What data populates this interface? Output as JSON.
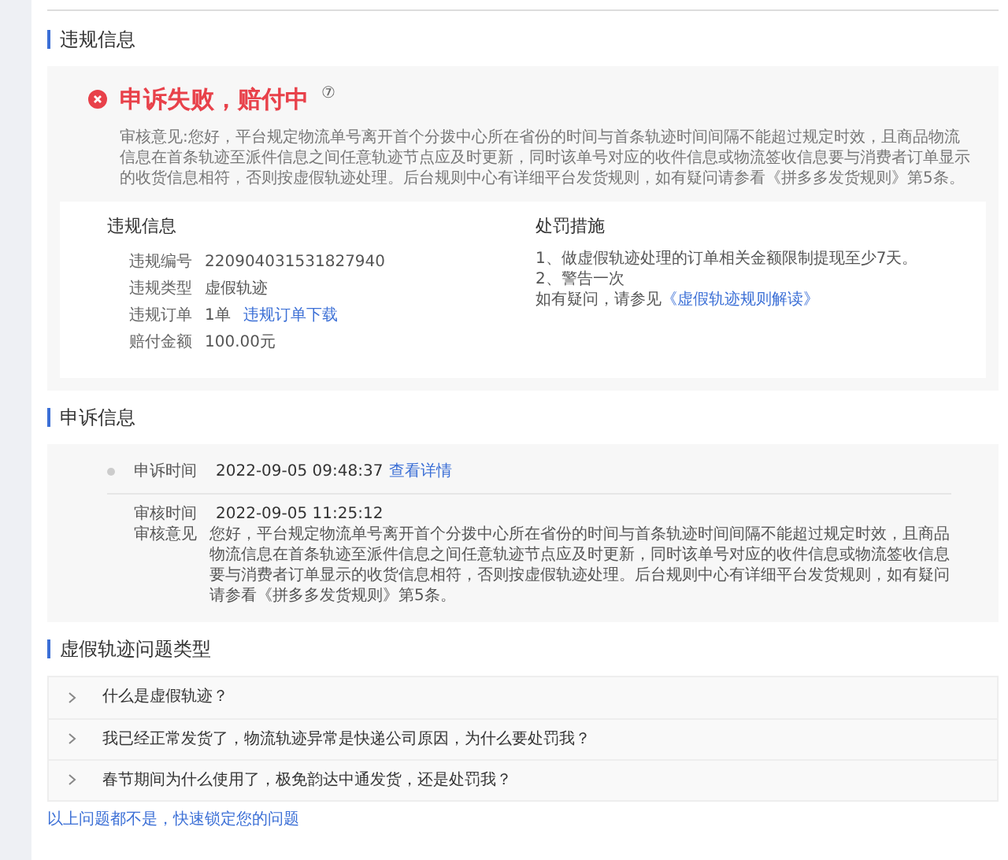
{
  "violation_section": {
    "title": "违规信息"
  },
  "status": {
    "kind": "failed",
    "title": "申诉失败，赔付中",
    "help_mark": "⑦",
    "text": "审核意见:您好，平台规定物流单号离开首个分拨中心所在省份的时间与首条轨迹时间间隔不能超过规定时效，且商品物流信息在首条轨迹至派件信息之间任意轨迹节点应及时更新，同时该单号对应的收件信息或物流签收信息要与消费者订单显示的收货信息相符，否则按虚假轨迹处理。后台规则中心有详细平台发货规则，如有疑问请参看《拼多多发货规则》第5条。"
  },
  "details": {
    "title": "违规信息",
    "rows": [
      {
        "label": "违规编号",
        "value": "220904031531827940"
      },
      {
        "label": "违规类型",
        "value": "虚假轨迹"
      },
      {
        "label": "违规订单",
        "value": "1单",
        "link": "违规订单下载"
      },
      {
        "label": "赔付金额",
        "value": "100.00元"
      }
    ]
  },
  "penalty": {
    "title": "处罚措施",
    "items": [
      "1、做虚假轨迹处理的订单相关金额限制提现至少7天。",
      "2、警告一次"
    ],
    "note": "如有疑问，请参见",
    "note_link": "《虚假轨迹规则解读》"
  },
  "appeal_section": {
    "title": "申诉信息"
  },
  "appeal": {
    "time_label": "申诉时间",
    "time": "2022-09-05 09:48:37",
    "detail_link": "查看详情",
    "review_time_label": "审核时间",
    "review_time": "2022-09-05 11:25:12",
    "opinion_label": "审核意见",
    "opinion": "您好，平台规定物流单号离开首个分拨中心所在省份的时间与首条轨迹时间间隔不能超过规定时效，且商品物流信息在首条轨迹至派件信息之间任意轨迹节点应及时更新，同时该单号对应的收件信息或物流签收信息要与消费者订单显示的收货信息相符，否则按虚假轨迹处理。后台规则中心有详细平台发货规则，如有疑问请参看《拼多多发货规则》第5条。"
  },
  "faq_section": {
    "title": "虚假轨迹问题类型"
  },
  "faq": [
    {
      "question": "什么是虚假轨迹？",
      "expanded": false
    },
    {
      "question": "我已经正常发货了，物流轨迹异常是快递公司原因，为什么要处罚我？",
      "expanded": false
    },
    {
      "question": "春节期间为什么使用了，极免韵达中通发货，还是处罚我？",
      "expanded": false
    }
  ],
  "footer_link": "以上问题都不是，快速锁定您的问题"
}
